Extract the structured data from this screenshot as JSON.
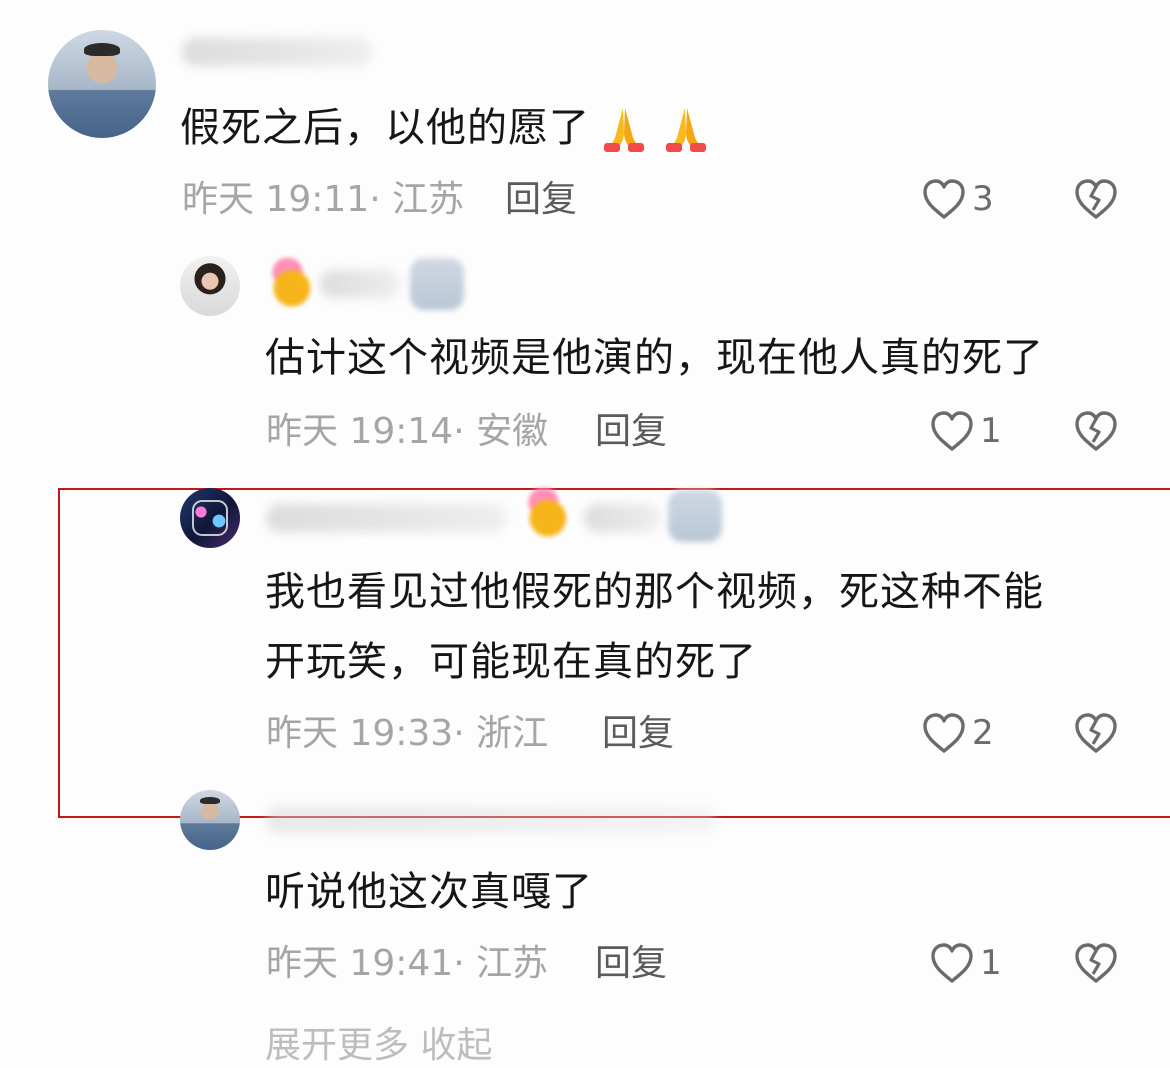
{
  "comments": [
    {
      "id": "c1",
      "text": "假死之后，以他的愿了",
      "emoji": "🙏🙏",
      "time": "昨天 19:11",
      "location": "· 江苏",
      "reply": "回复",
      "likes": "3",
      "avatar": "man-photo"
    },
    {
      "id": "c2",
      "text": "估计这个视频是他演的，现在他人真的死了",
      "time": "昨天 19:14",
      "location": "· 安徽",
      "reply": "回复",
      "likes": "1",
      "avatar": "woman-photo"
    },
    {
      "id": "c3",
      "text_line1": "我也看见过他假死的那个视频，死这种不能",
      "text_line2": "开玩笑，可能现在真的死了",
      "time": "昨天 19:33",
      "location": "· 浙江",
      "reply": "回复",
      "likes": "2",
      "avatar": "fantasy-art"
    },
    {
      "id": "c4",
      "text": "听说他这次真嘎了",
      "time": "昨天 19:41",
      "location": "· 江苏",
      "reply": "回复",
      "likes": "1",
      "avatar": "man-photo"
    }
  ],
  "footer": {
    "hint": "展开更多   收起"
  },
  "colors": {
    "highlight_border": "#c21818",
    "meta_text": "#a5a5a5",
    "reply_text": "#5b5b5b"
  }
}
